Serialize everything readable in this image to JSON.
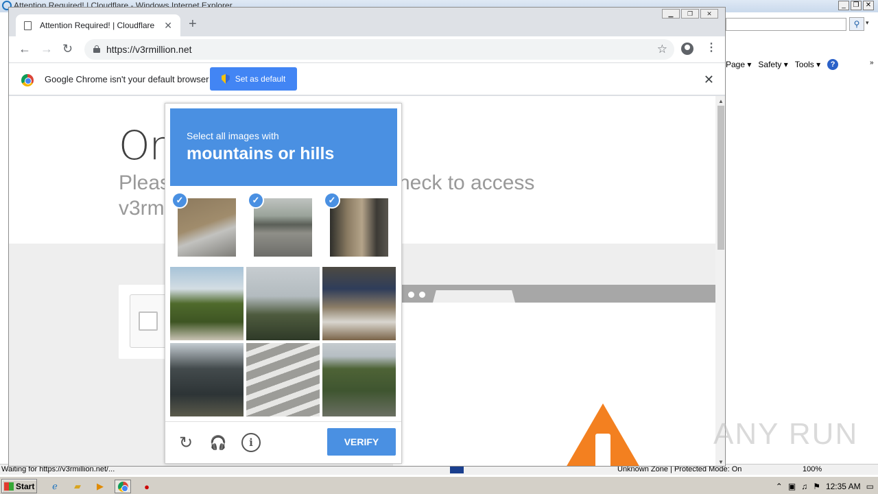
{
  "ie": {
    "title": "Attention Required! | Cloudflare - Windows Internet Explorer",
    "command_bar": [
      "Page ▾",
      "Safety ▾",
      "Tools ▾"
    ],
    "status_left": "Waiting for https://v3rmillion.net/...",
    "zone": "Unknown Zone | Protected Mode: On",
    "zoom": "100%"
  },
  "chrome": {
    "tab_title": "Attention Required! | Cloudflare",
    "new_tab": "+",
    "url": "https://v3rmillion.net",
    "infobar_text": "Google Chrome isn't your default browser",
    "set_default_label": "Set as default"
  },
  "cloudflare": {
    "title_visible": "On",
    "subtitle_visible_a": "Pleas",
    "subtitle_visible_b": "heck to access",
    "subtitle_visible_c": "v3rm"
  },
  "captcha": {
    "instruction": "Select all images with",
    "target": "mountains or hills",
    "verify_label": "VERIFY",
    "tiles": [
      {
        "name": "tile-1",
        "selected": true,
        "scene": "hillside road with concrete barrier"
      },
      {
        "name": "tile-2",
        "selected": true,
        "scene": "highway overpass"
      },
      {
        "name": "tile-3",
        "selected": true,
        "scene": "city street traffic light"
      },
      {
        "name": "tile-4",
        "selected": false,
        "scene": "trees and sky"
      },
      {
        "name": "tile-5",
        "selected": false,
        "scene": "palm tree and hill"
      },
      {
        "name": "tile-6",
        "selected": false,
        "scene": "picnic table and car"
      },
      {
        "name": "tile-7",
        "selected": false,
        "scene": "house roof"
      },
      {
        "name": "tile-8",
        "selected": false,
        "scene": "crosswalk and truck"
      },
      {
        "name": "tile-9",
        "selected": false,
        "scene": "green hills landscape"
      }
    ]
  },
  "taskbar": {
    "start_label": "Start",
    "clock": "12:35 AM"
  },
  "watermark": "ANY RUN",
  "colors": {
    "captcha_blue": "#4a90e2",
    "chrome_blue": "#4285f4",
    "cloudflare_orange": "#f38020"
  }
}
